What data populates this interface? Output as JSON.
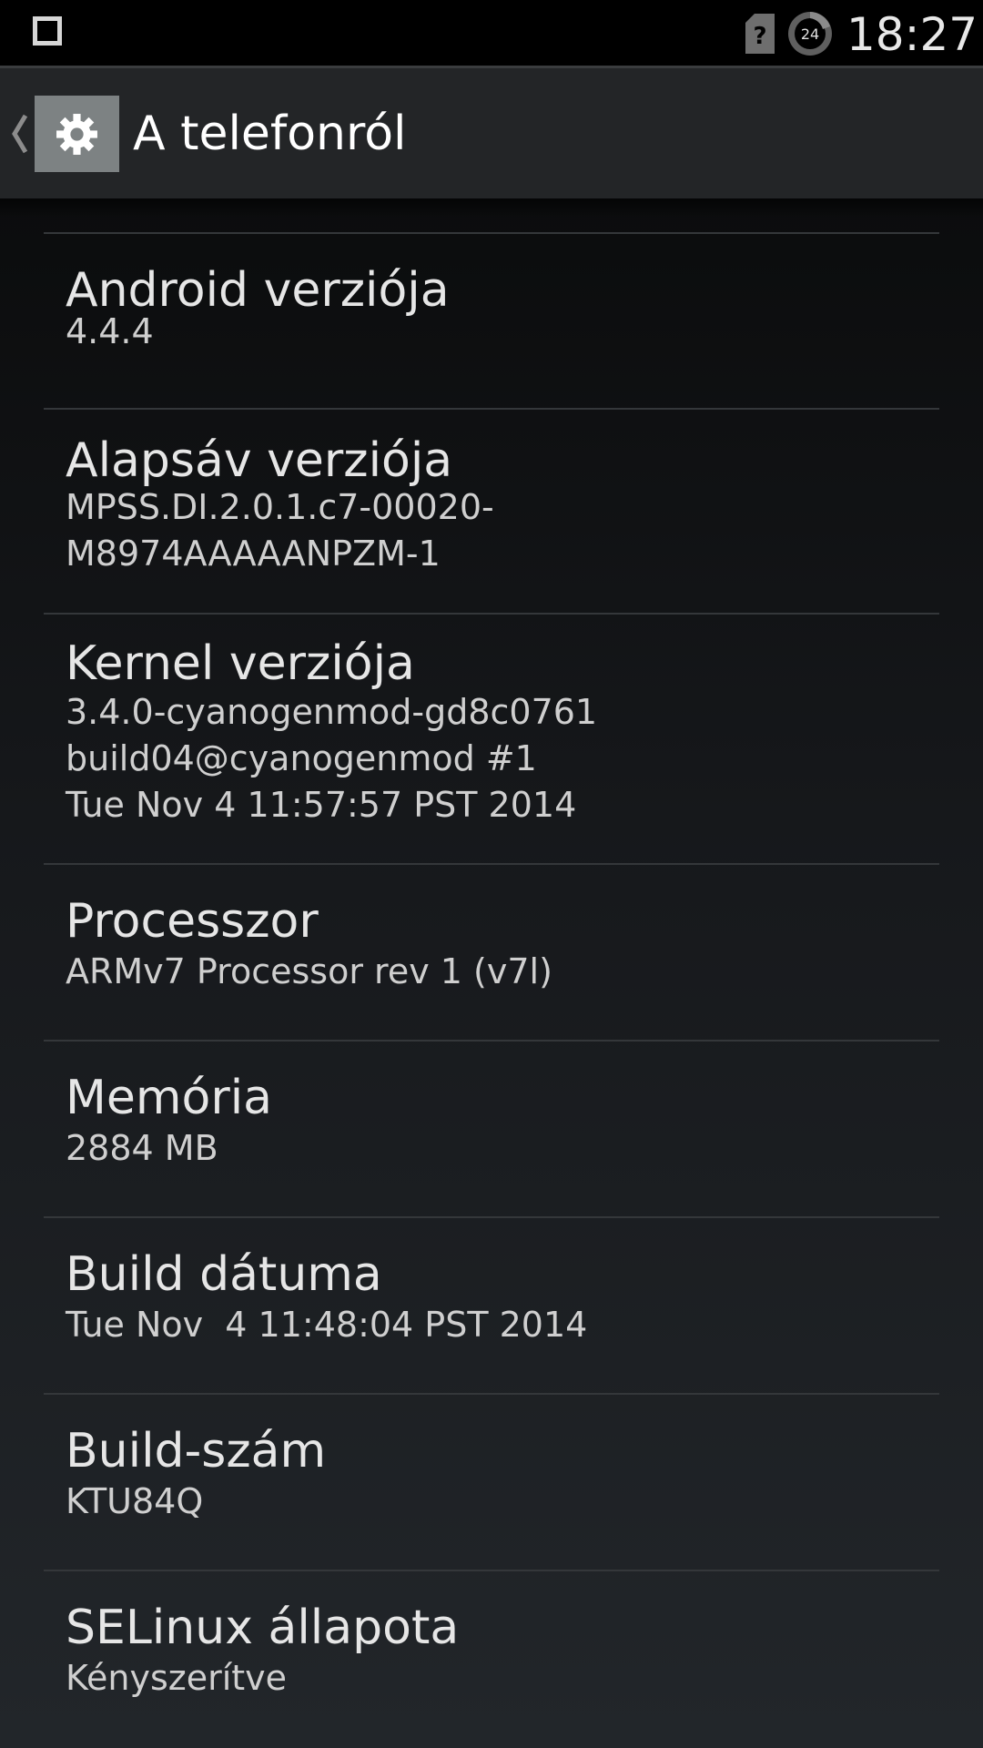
{
  "status_bar": {
    "time": "18:27",
    "alarm_badge": "24",
    "icons": [
      "recent-apps-square-icon",
      "sim-unknown-icon",
      "timer-24-icon"
    ]
  },
  "action_bar": {
    "title": "A telefonról",
    "icon": "settings-gear-icon"
  },
  "items": [
    {
      "title": "Android verziója",
      "summary": "4.4.4"
    },
    {
      "title": "Alapsáv verziója",
      "summary": "MPSS.DI.2.0.1.c7-00020-\nM8974AAAAANPZM-1"
    },
    {
      "title": "Kernel verziója",
      "summary": "3.4.0-cyanogenmod-gd8c0761\nbuild04@cyanogenmod #1\nTue Nov 4 11:57:57 PST 2014"
    },
    {
      "title": "Processzor",
      "summary": "ARMv7 Processor rev 1 (v7l)"
    },
    {
      "title": "Memória",
      "summary": "2884 MB"
    },
    {
      "title": "Build dátuma",
      "summary": "Tue Nov  4 11:48:04 PST 2014"
    },
    {
      "title": "Build-szám",
      "summary": "KTU84Q"
    },
    {
      "title": "SELinux állapota",
      "summary": "Kényszerítve"
    }
  ],
  "colors": {
    "background_top": "#0b0c0d",
    "background_bottom": "#22262a",
    "action_bar": "#232527",
    "icon_bg": "#7d8283",
    "divider": "#34373a",
    "title_text": "#e6e6e6",
    "summary_text": "#cfcfcf"
  }
}
